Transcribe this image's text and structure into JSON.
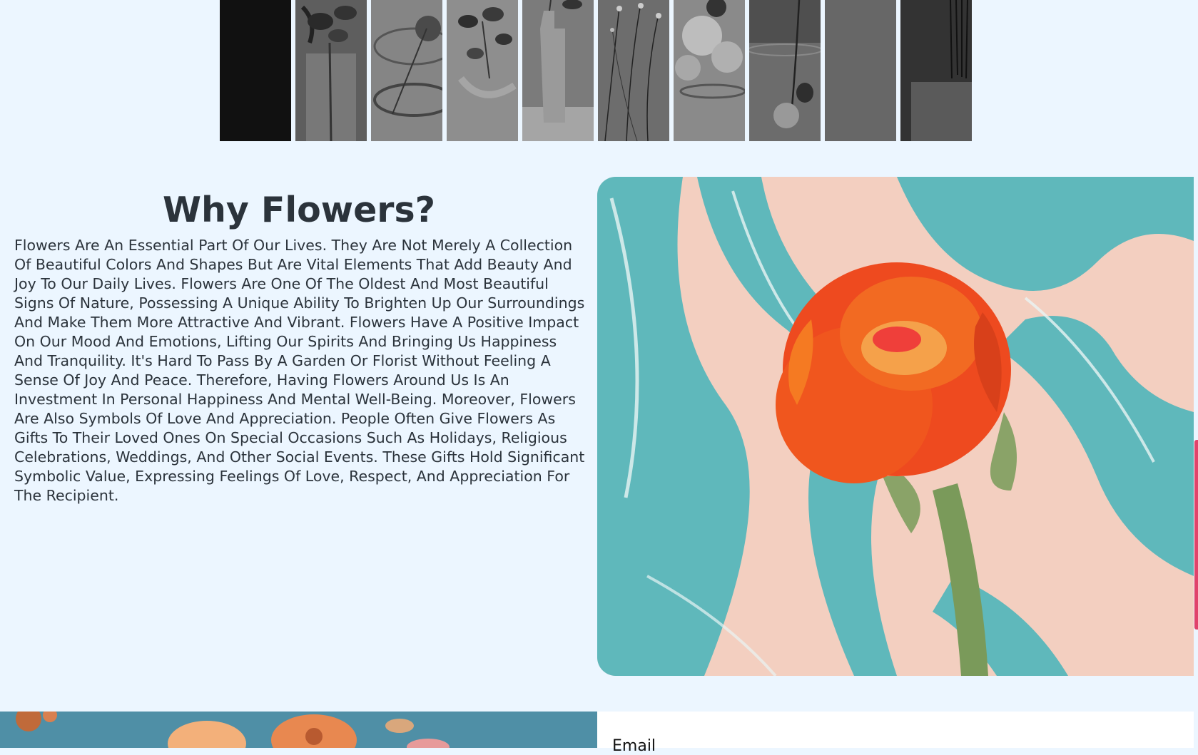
{
  "gallery": {
    "panels": [
      {
        "name": "dark-panel",
        "tone": "#111111"
      },
      {
        "name": "flower-in-glass-vase",
        "tone": "#6a6a6a"
      },
      {
        "name": "glass-bowl-flower",
        "tone": "#7d7d7d"
      },
      {
        "name": "leafy-branch",
        "tone": "#8a8a8a"
      },
      {
        "name": "white-vase",
        "tone": "#7a7a7a"
      },
      {
        "name": "wildflower-stems",
        "tone": "#6f6f6f"
      },
      {
        "name": "white-blossoms",
        "tone": "#8c8c8c"
      },
      {
        "name": "hanging-flower",
        "tone": "#5c5c5c"
      },
      {
        "name": "gray-panel",
        "tone": "#666666"
      },
      {
        "name": "dark-pedestal",
        "tone": "#3a3a3a"
      }
    ]
  },
  "why": {
    "title": "Why Flowers?",
    "body": "Flowers Are An Essential Part Of Our Lives. They Are Not Merely A Collection Of Beautiful Colors And Shapes But Are Vital Elements That Add Beauty And Joy To Our Daily Lives. Flowers Are One Of The Oldest And Most Beautiful Signs Of Nature, Possessing A Unique Ability To Brighten Up Our Surroundings And Make Them More Attractive And Vibrant. Flowers Have A Positive Impact On Our Mood And Emotions, Lifting Our Spirits And Bringing Us Happiness And Tranquility. It's Hard To Pass By A Garden Or Florist Without Feeling A Sense Of Joy And Peace. Therefore, Having Flowers Around Us Is An Investment In Personal Happiness And Mental Well-Being. Moreover, Flowers Are Also Symbols Of Love And Appreciation. People Often Give Flowers As Gifts To Their Loved Ones On Special Occasions Such As Holidays, Religious Celebrations, Weddings, And Other Social Events. These Gifts Hold Significant Symbolic Value, Expressing Feelings Of Love, Respect, And Appreciation For The Recipient."
  },
  "hero": {
    "image": "orange-ranunculus-on-marbled-background",
    "colors": {
      "teal": "#5fb8bb",
      "peach": "#f3cfc0",
      "petal": "#ee4a1f",
      "stem": "#7a9a5a"
    }
  },
  "form": {
    "email_label": "Email"
  },
  "theme": {
    "background": "#ecf6ff",
    "text": "#2b333b",
    "accent": "#e0436b"
  }
}
